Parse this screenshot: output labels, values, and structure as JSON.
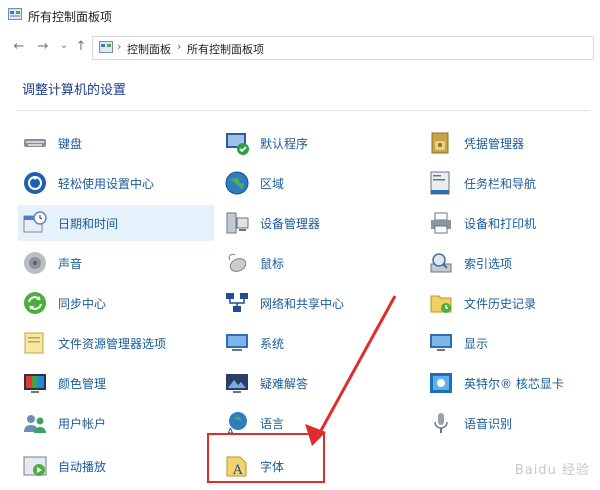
{
  "window": {
    "title": "所有控制面板项"
  },
  "nav": {
    "back": "←",
    "forward": "→",
    "dropdown": "⌄",
    "up": "↑"
  },
  "breadcrumb": {
    "sep1": "›",
    "item1": "控制面板",
    "sep2": "›",
    "item2": "所有控制面板项"
  },
  "page": {
    "title": "调整计算机的设置"
  },
  "items": [
    {
      "label": "键盘",
      "icon": "keyboard-icon"
    },
    {
      "label": "默认程序",
      "icon": "default-programs-icon"
    },
    {
      "label": "凭据管理器",
      "icon": "credential-manager-icon"
    },
    {
      "label": "轻松使用设置中心",
      "icon": "ease-of-access-icon"
    },
    {
      "label": "区域",
      "icon": "region-globe-icon"
    },
    {
      "label": "任务栏和导航",
      "icon": "taskbar-icon"
    },
    {
      "label": "日期和时间",
      "icon": "date-time-icon"
    },
    {
      "label": "设备管理器",
      "icon": "device-manager-icon"
    },
    {
      "label": "设备和打印机",
      "icon": "printer-icon"
    },
    {
      "label": "声音",
      "icon": "sound-icon"
    },
    {
      "label": "鼠标",
      "icon": "mouse-icon"
    },
    {
      "label": "索引选项",
      "icon": "indexing-icon"
    },
    {
      "label": "同步中心",
      "icon": "sync-icon"
    },
    {
      "label": "网络和共享中心",
      "icon": "network-icon"
    },
    {
      "label": "文件历史记录",
      "icon": "file-history-icon"
    },
    {
      "label": "文件资源管理器选项",
      "icon": "folder-options-icon"
    },
    {
      "label": "系统",
      "icon": "system-icon"
    },
    {
      "label": "显示",
      "icon": "display-icon"
    },
    {
      "label": "颜色管理",
      "icon": "color-management-icon"
    },
    {
      "label": "疑难解答",
      "icon": "troubleshooting-icon"
    },
    {
      "label": "英特尔® 核芯显卡",
      "icon": "intel-graphics-icon"
    },
    {
      "label": "用户帐户",
      "icon": "user-accounts-icon"
    },
    {
      "label": "语言",
      "icon": "language-icon"
    },
    {
      "label": "语音识别",
      "icon": "microphone-icon"
    },
    {
      "label": "自动播放",
      "icon": "autoplay-icon"
    },
    {
      "label": "字体",
      "icon": "fonts-icon"
    }
  ],
  "watermark": "Baidu 经验"
}
